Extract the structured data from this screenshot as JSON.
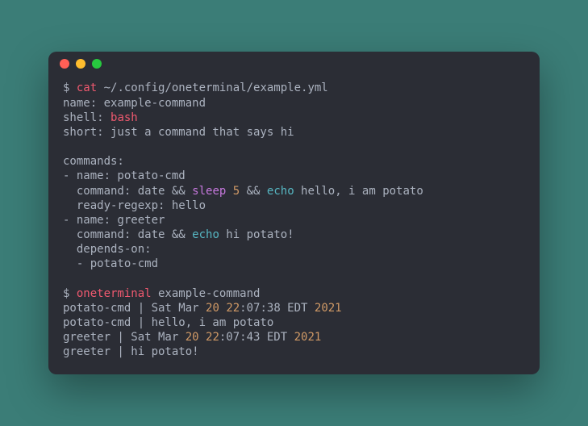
{
  "prompt": "$ ",
  "cmd1": {
    "name": "cat",
    "arg": " ~/.config/oneterminal/example.yml"
  },
  "yaml": {
    "line1": "name: example-command",
    "line2a": "shell: ",
    "line2b": "bash",
    "line3": "short: just a command that says hi",
    "line5": "commands:",
    "line6": "- name: potato-cmd",
    "line7a": "  command: date && ",
    "line7b": "sleep",
    "line7c": " ",
    "line7d": "5",
    "line7e": " && ",
    "line7f": "echo",
    "line7g": " hello, i am potato",
    "line8": "  ready-regexp: hello",
    "line9": "- name: greeter",
    "line10a": "  command: date && ",
    "line10b": "echo",
    "line10c": " hi potato!",
    "line11": "  depends-on:",
    "line12": "  - potato-cmd"
  },
  "cmd2": {
    "name": "oneterminal",
    "arg": " example-command"
  },
  "output": {
    "l1a": "potato-cmd | Sat Mar ",
    "l1b": "20",
    "l1c": " ",
    "l1d": "22",
    "l1e": ":07:38 EDT ",
    "l1f": "2021",
    "l2": "potato-cmd | hello, i am potato",
    "l3a": "greeter | Sat Mar ",
    "l3b": "20",
    "l3c": " ",
    "l3d": "22",
    "l3e": ":07:43 EDT ",
    "l3f": "2021",
    "l4": "greeter | hi potato!"
  }
}
